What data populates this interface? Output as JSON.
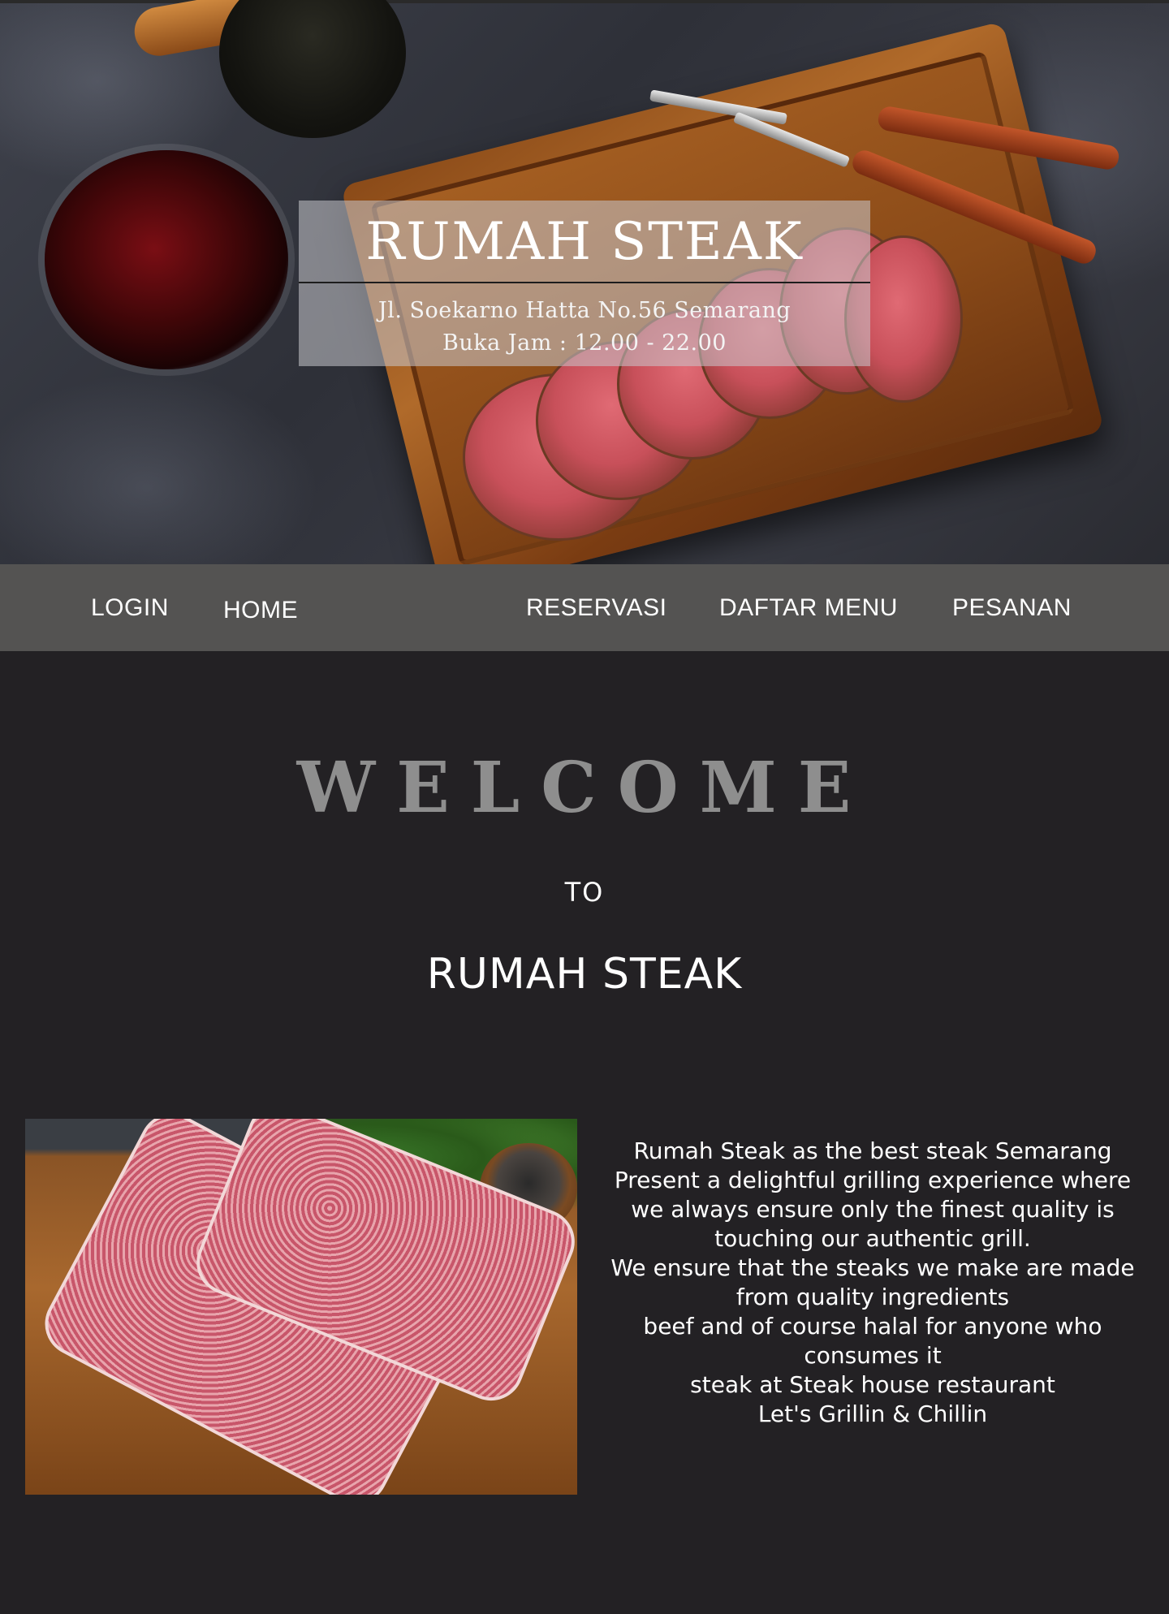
{
  "hero": {
    "title": "RUMAH STEAK",
    "address": "Jl. Soekarno Hatta No.56 Semarang",
    "hours": "Buka Jam : 12.00 - 22.00"
  },
  "nav": {
    "items": [
      {
        "label": "LOGIN"
      },
      {
        "label": "HOME"
      },
      {
        "label": "RESERVASI"
      },
      {
        "label": "DAFTAR MENU"
      },
      {
        "label": "PESANAN"
      }
    ]
  },
  "welcome": {
    "heading": "WELCOME",
    "to": "TO",
    "brand": "RUMAH STEAK"
  },
  "about": {
    "lines": [
      "Rumah Steak as the best steak Semarang",
      "Present a delightful grilling experience where",
      "we always ensure only the finest quality is",
      "touching our authentic grill.",
      "We ensure that the steaks we make are made",
      "from quality ingredients",
      "beef and of course halal for anyone who",
      "consumes it",
      "steak at Steak house restaurant",
      "Let's Grillin & Chillin"
    ]
  }
}
